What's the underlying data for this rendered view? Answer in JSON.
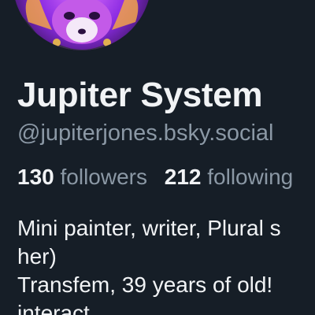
{
  "profile": {
    "display_name": "Jupiter System",
    "handle": "@jupiterjones.bsky.social",
    "followers_count": "130",
    "followers_label": "followers",
    "following_count": "212",
    "following_label": "following",
    "bio_lines": [
      "Mini painter, writer, Plural s",
      "her)",
      "Transfem, 39 years of old!",
      "interact"
    ]
  },
  "colors": {
    "background": "#161e27",
    "primary_text": "#f1f3f5",
    "secondary_text": "#8b98a5"
  }
}
